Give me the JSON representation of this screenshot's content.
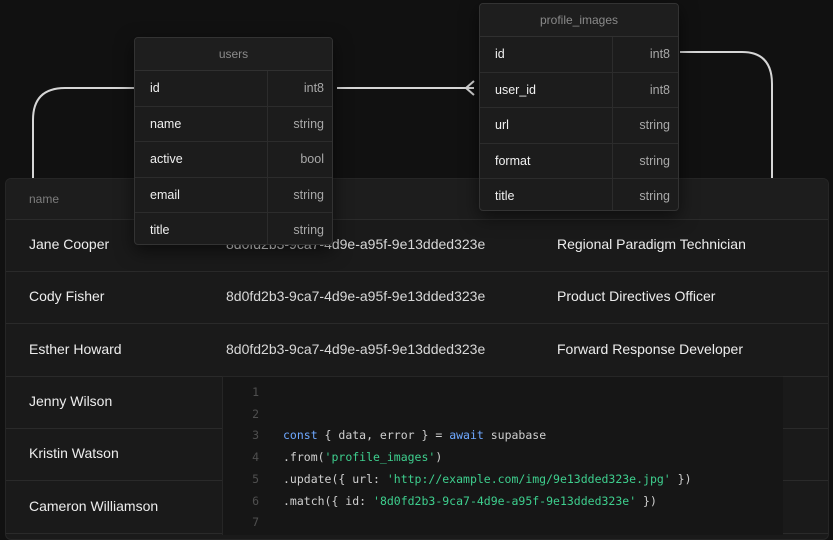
{
  "users_table": {
    "title": "users",
    "fields": [
      {
        "name": "id",
        "type": "int8"
      },
      {
        "name": "name",
        "type": "string"
      },
      {
        "name": "active",
        "type": "bool"
      },
      {
        "name": "email",
        "type": "string"
      },
      {
        "name": "title",
        "type": "string"
      }
    ]
  },
  "profile_images_table": {
    "title": "profile_images",
    "fields": [
      {
        "name": "id",
        "type": "int8"
      },
      {
        "name": "user_id",
        "type": "int8"
      },
      {
        "name": "url",
        "type": "string"
      },
      {
        "name": "format",
        "type": "string"
      },
      {
        "name": "title",
        "type": "string"
      }
    ]
  },
  "data_table": {
    "header": "name",
    "rows": [
      {
        "name": "Jane Cooper",
        "id": "8d0fd2b3-9ca7-4d9e-a95f-9e13dded323e",
        "title": "Regional Paradigm Technician"
      },
      {
        "name": "Cody Fisher",
        "id": "8d0fd2b3-9ca7-4d9e-a95f-9e13dded323e",
        "title": "Product Directives Officer"
      },
      {
        "name": "Esther Howard",
        "id": "8d0fd2b3-9ca7-4d9e-a95f-9e13dded323e",
        "title": "Forward Response Developer"
      },
      {
        "name": "Jenny Wilson",
        "id": "",
        "title": ""
      },
      {
        "name": "Kristin Watson",
        "id": "",
        "title": ""
      },
      {
        "name": "Cameron Williamson",
        "id": "",
        "title": ""
      }
    ]
  },
  "code": {
    "lines": [
      {
        "num": "1",
        "tokens": []
      },
      {
        "num": "2",
        "tokens": []
      },
      {
        "num": "3",
        "tokens": [
          {
            "t": "const",
            "k": "kw"
          },
          {
            "t": " { data, error } = ",
            "k": "plain"
          },
          {
            "t": "await",
            "k": "kw"
          },
          {
            "t": " supabase",
            "k": "plain"
          }
        ]
      },
      {
        "num": "4",
        "tokens": [
          {
            "t": ".from(",
            "k": "plain"
          },
          {
            "t": "'profile_images'",
            "k": "str"
          },
          {
            "t": ")",
            "k": "plain"
          }
        ]
      },
      {
        "num": "5",
        "tokens": [
          {
            "t": ".update({ url: ",
            "k": "plain"
          },
          {
            "t": "'http://example.com/img/9e13dded323e.jpg'",
            "k": "str"
          },
          {
            "t": " })",
            "k": "plain"
          }
        ]
      },
      {
        "num": "6",
        "tokens": [
          {
            "t": ".match({ id: ",
            "k": "plain"
          },
          {
            "t": "'8d0fd2b3-9ca7-4d9e-a95f-9e13dded323e'",
            "k": "str"
          },
          {
            "t": " })",
            "k": "plain"
          }
        ]
      },
      {
        "num": "7",
        "tokens": []
      }
    ]
  },
  "colors": {
    "background": "#111111",
    "keyword": "#6ea8ff",
    "string": "#3ecf8e",
    "connector": "#cfcfcf"
  }
}
